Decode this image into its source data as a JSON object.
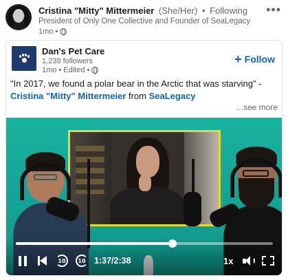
{
  "author": {
    "name": "Cristina \"Mitty\" Mittermeier",
    "pronouns": "(She/Her)",
    "separator": "•",
    "connection": "Following",
    "headline": "President of Only One Collective and Founder of SeaLegacy",
    "time": "1mo",
    "time_separator": "•",
    "more_label": "•••"
  },
  "shared": {
    "company_name": "Dan's Pet Care",
    "followers": "1,238 followers",
    "time": "1mo",
    "separator": "•",
    "edited": "Edited",
    "follow_label": "Follow",
    "follow_plus": "+"
  },
  "post": {
    "text_part1": "\"In 2017, we found a polar bear in the Arctic that was starving\" - ",
    "link_person": "Cristina \"Mitty\" Mittermeier",
    "text_part2": " from ",
    "link_org": "SeaLegacy",
    "see_more": "...see more"
  },
  "video": {
    "progress_fraction": 0.61,
    "current_time": "1:37",
    "duration": "2:38",
    "time_separator": " / ",
    "rewind_seconds": "10",
    "forward_seconds": "10",
    "speed": "1x"
  },
  "colors": {
    "link": "#0a66c2",
    "video_bg": "#18b3a1",
    "screen_frame": "#e5d92e"
  }
}
